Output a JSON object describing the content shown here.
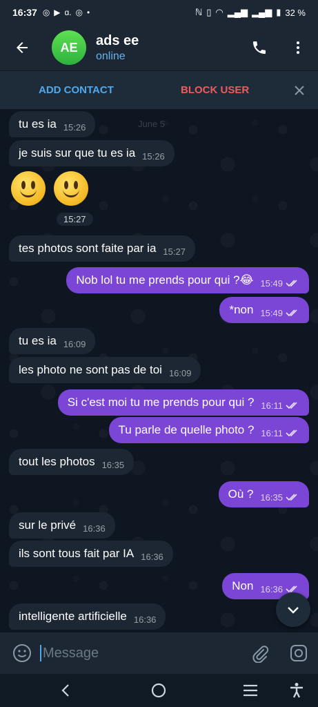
{
  "status_bar": {
    "time": "16:37",
    "app_icons": [
      "instagram-icon",
      "youtube-icon",
      "a-icon",
      "instagram-icon"
    ],
    "battery": "32 %"
  },
  "header": {
    "avatar_initials": "AE",
    "name": "ads ee",
    "status": "online"
  },
  "action_bar": {
    "add_contact": "ADD CONTACT",
    "block_user": "BLOCK USER"
  },
  "date_pill": "June 5",
  "messages": [
    {
      "dir": "in",
      "text": "tu es ia",
      "time": "15:26"
    },
    {
      "dir": "in",
      "text": "je suis sur que tu es ia",
      "time": "15:26"
    },
    {
      "dir": "in",
      "text": "🙂🙂",
      "time": "15:27"
    },
    {
      "dir": "in",
      "text": "tes photos sont faite par ia",
      "time": "15:27"
    },
    {
      "dir": "out",
      "text": "Nob lol tu me prends pour qui ?😂",
      "time": "15:49"
    },
    {
      "dir": "out",
      "text": "*non",
      "time": "15:49"
    },
    {
      "dir": "in",
      "text": "tu es ia",
      "time": "16:09"
    },
    {
      "dir": "in",
      "text": "les photo ne sont pas de toi",
      "time": "16:09"
    },
    {
      "dir": "out",
      "text": "Si c'est moi tu me prends pour qui ?",
      "time": "16:11"
    },
    {
      "dir": "out",
      "text": "Tu parle de quelle photo ?",
      "time": "16:11"
    },
    {
      "dir": "in",
      "text": "tout les photos",
      "time": "16:35"
    },
    {
      "dir": "out",
      "text": "Où ?",
      "time": "16:35"
    },
    {
      "dir": "in",
      "text": "sur le privé",
      "time": "16:36"
    },
    {
      "dir": "in",
      "text": "ils sont tous fait par IA",
      "time": "16:36"
    },
    {
      "dir": "out",
      "text": "Non",
      "time": "16:36"
    },
    {
      "dir": "in",
      "text": "intelligente artificielle",
      "time": "16:36"
    }
  ],
  "input": {
    "placeholder": "Message"
  },
  "colors": {
    "background": "#0e1621",
    "incoming_bubble": "#1c2733",
    "outgoing_bubble": "#7b46d6",
    "accent_blue": "#4fa9ee",
    "danger_red": "#ef5b5b"
  }
}
